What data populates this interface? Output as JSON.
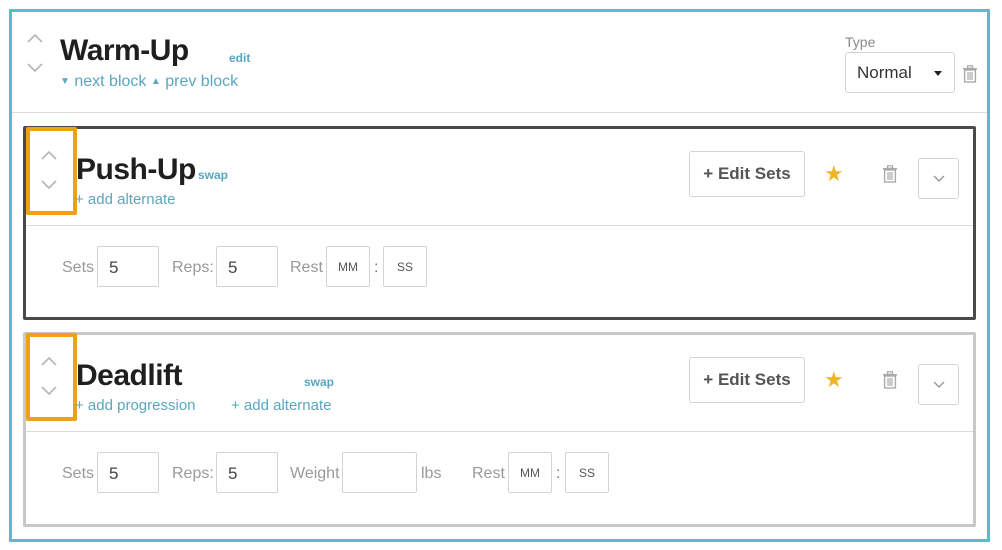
{
  "block": {
    "title": "Warm-Up",
    "edit_label": "edit",
    "next_label": "next block",
    "prev_label": "prev block",
    "type_label": "Type",
    "type_value": "Normal"
  },
  "exercises": [
    {
      "name": "Push-Up",
      "swap_label": "swap",
      "links": [
        "+ add alternate"
      ],
      "edit_sets_label": "+ Edit Sets",
      "fields": {
        "sets_label": "Sets",
        "sets_value": "5",
        "reps_label": "Reps:",
        "reps_value": "5",
        "rest_label": "Rest",
        "rest_mm": "MM",
        "rest_ss": "SS",
        "colon": ":"
      }
    },
    {
      "name": "Deadlift",
      "swap_label": "swap",
      "links": [
        "+ add progression",
        "+ add alternate"
      ],
      "edit_sets_label": "+ Edit Sets",
      "fields": {
        "sets_label": "Sets",
        "sets_value": "5",
        "reps_label": "Reps:",
        "reps_value": "5",
        "weight_label": "Weight",
        "weight_value": "",
        "weight_unit": "lbs",
        "rest_label": "Rest",
        "rest_mm": "MM",
        "rest_ss": "SS",
        "colon": ":"
      }
    }
  ],
  "icons": {
    "chevron_up": "chevron-up-icon",
    "chevron_down": "chevron-down-icon",
    "trash": "trash-icon",
    "star": "star-icon",
    "caret": "caret-down-icon"
  },
  "colors": {
    "block_border": "#5bbcc7",
    "link": "#5aa6c2",
    "star": "#f0b429",
    "handle_highlight": "#f0a010",
    "active_border": "#4a4a4a",
    "inactive_border": "#c8c8c8"
  }
}
